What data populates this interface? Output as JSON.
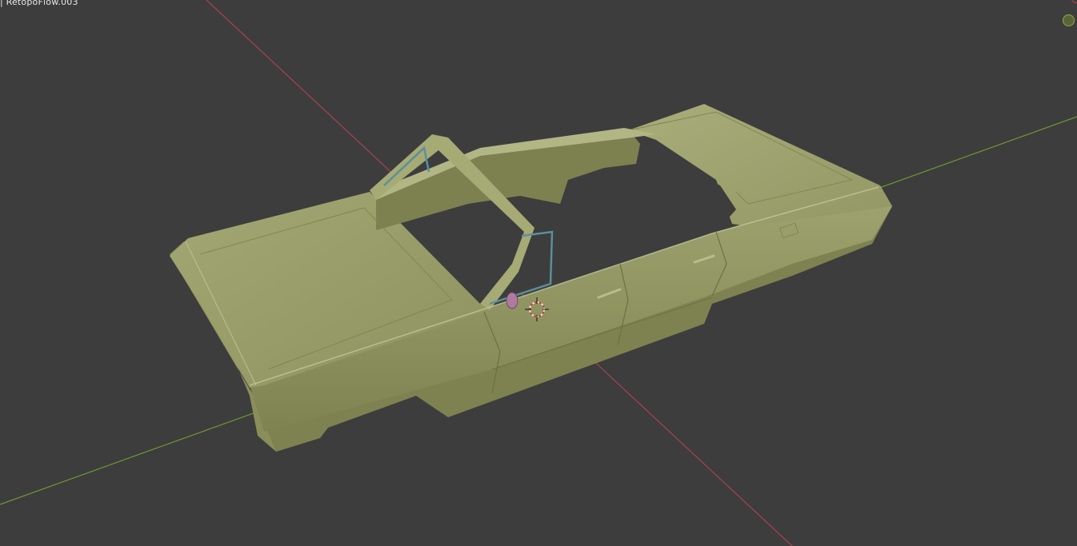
{
  "viewport": {
    "title_text": "| RetopoFlow.003",
    "background": "#3d3d3d",
    "axis_colors": {
      "x": "#a8434e",
      "y": "#6e9a2e"
    },
    "model_color": "#9ca06a"
  },
  "gizmo": {
    "icons": [
      "axis-y-icon",
      "axis-x-icon"
    ]
  }
}
